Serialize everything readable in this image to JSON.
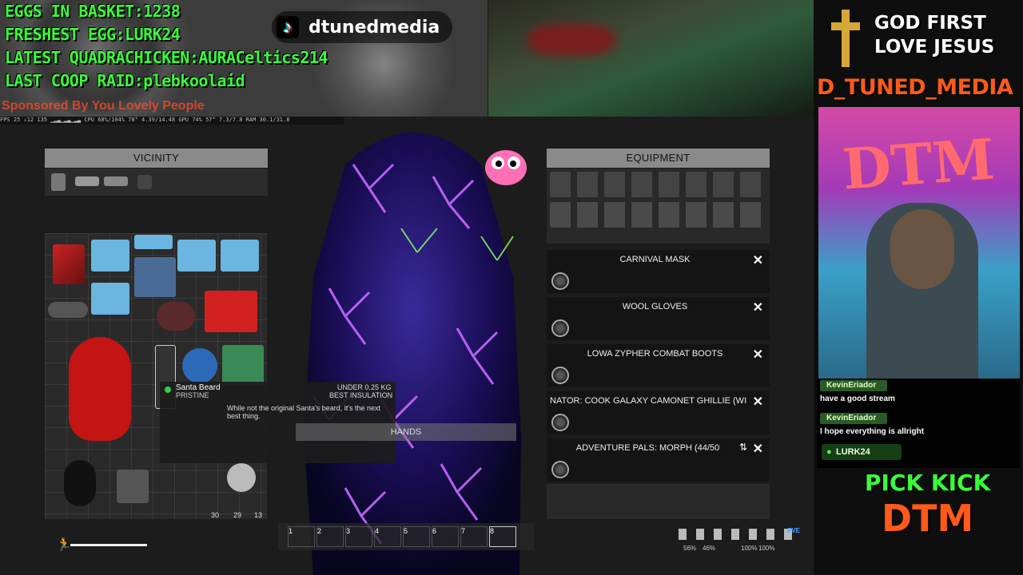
{
  "overlay": {
    "stats": [
      {
        "label": "EGGS IN BASKET:",
        "value": "1238"
      },
      {
        "label": "FRESHEST EGG:",
        "value": "LURK24"
      },
      {
        "label": "LATEST QUADRACHICKEN:",
        "value": "AURACeltics214"
      },
      {
        "label": "LAST COOP RAID:",
        "value": "plebkoolaid"
      }
    ],
    "sponsor": "Sponsored By You Lovely People",
    "tiktok_handle": "dtunedmedia",
    "perf_text": "FPS 25  ↓12 135  ▁▂▃▁▂▃▁▂▃  CPU 68%/104%  78°  4.39/14.48  GPU 74%  57°  7.3/7.8  RAM 30.1/31.8",
    "god_line1": "GOD FIRST",
    "god_line2": "LOVE JESUS",
    "channel_name": "D_TUNED_MEDIA",
    "webcam_sign": "DTM",
    "pick_kick": "PICK KICK",
    "dtm": "DTM"
  },
  "chat": [
    {
      "user": "KevinEriador",
      "message": "have a good stream"
    },
    {
      "user": "KevinEriador",
      "message": "I hope everything is allright"
    }
  ],
  "chat_badge": "LURK24",
  "game": {
    "vicinity_title": "VICINITY",
    "equipment_title": "EQUIPMENT",
    "equipment_items": [
      {
        "name": "CARNIVAL MASK"
      },
      {
        "name": "WOOL GLOVES"
      },
      {
        "name": "LOWA ZYPHER COMBAT BOOTS"
      },
      {
        "name": "NATOR: COOK GALAXY CAMONET GHILLIE (WIN"
      },
      {
        "name": "ADVENTURE PALS: MORPH (44/50"
      }
    ],
    "close_glyph": "✕",
    "tooltip": {
      "item_name": "Santa Beard",
      "condition": "PRISTINE",
      "weight": "UNDER 0.25 KG",
      "property": "BEST INSULATION",
      "description": "While not the original Santa's beard, it's the next best thing."
    },
    "hands_label": "HANDS",
    "hotbar_slots": [
      "1",
      "2",
      "3",
      "4",
      "5",
      "6",
      "7",
      "8"
    ],
    "inventory_counts": [
      "30",
      "29",
      "13"
    ],
    "status_values": [
      "56%",
      "46%",
      "100%",
      "100%"
    ],
    "pve_label": "PVE"
  },
  "colors": {
    "stat_green": "#38ff3a",
    "accent_orange": "#ff5a1a",
    "panel_gray": "#8a8a8a"
  }
}
